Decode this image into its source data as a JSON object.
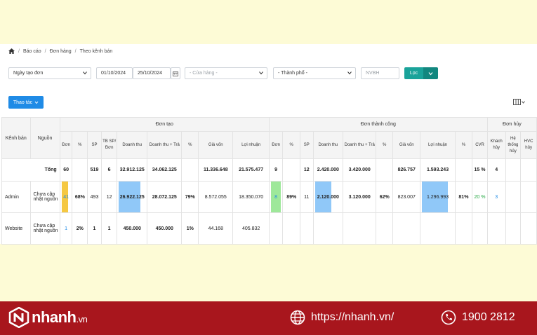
{
  "breadcrumb": [
    "Báo cáo",
    "Đơn hàng",
    "Theo kênh bán"
  ],
  "filters": {
    "date_type": "Ngày tạo đơn",
    "date_from": "01/10/2024",
    "date_to": "25/10/2024",
    "store_placeholder": "- Cửa hàng -",
    "city_placeholder": "- Thành phố -",
    "staff_placeholder": "NVBH",
    "filter_button": "Lọc"
  },
  "actions_button": "Thao tác",
  "table": {
    "group_headers": {
      "channel": "Kênh bán",
      "source": "Nguồn",
      "created": "Đơn tạo",
      "success": "Đơn thành công",
      "cancelled": "Đơn hủy"
    },
    "created_cols": [
      "Đơn",
      "%",
      "SP",
      "TB SP/ Đơn",
      "Doanh thu",
      "Doanh thu + Trả",
      "%",
      "Giá vốn",
      "Lợi nhuận"
    ],
    "success_cols": [
      "Đơn",
      "%",
      "SP",
      "Doanh thu",
      "Doanh thu + Trả",
      "%",
      "Giá vốn",
      "Lợi nhuận",
      "%",
      "CVR"
    ],
    "cancel_cols": [
      "Khách hủy",
      "Hệ thống hủy",
      "HVC hủy"
    ],
    "total": {
      "label": "Tổng",
      "created": [
        "60",
        "",
        "519",
        "6",
        "32.912.125",
        "34.062.125",
        "",
        "11.336.648",
        "21.575.477"
      ],
      "success": [
        "9",
        "",
        "12",
        "2.420.000",
        "3.420.000",
        "",
        "826.757",
        "1.593.243",
        "",
        "15 %"
      ],
      "cancel": [
        "4",
        "",
        ""
      ]
    },
    "rows": [
      {
        "channel": "Admin",
        "source": "Chưa cập nhật nguồn",
        "created": [
          "41",
          "68%",
          "493",
          "12",
          "26.922.125",
          "28.072.125",
          "79%",
          "8.572.055",
          "18.350.070"
        ],
        "success": [
          "8",
          "89%",
          "11",
          "2.120.000",
          "3.120.000",
          "62%",
          "823.007",
          "1.296.993",
          "81%",
          "20 %"
        ],
        "cancel": [
          "3",
          "",
          ""
        ]
      },
      {
        "channel": "Website",
        "source": "Chưa cập nhật nguồn",
        "created": [
          "1",
          "2%",
          "1",
          "1",
          "450.000",
          "450.000",
          "1%",
          "44.168",
          "405.832"
        ],
        "success": [
          "",
          "",
          "",
          "",
          "",
          "",
          "",
          "",
          "",
          ""
        ],
        "cancel": [
          "",
          "",
          ""
        ]
      }
    ],
    "highlights": {
      "orders_admin_fraction": 0.68,
      "revenue_admin_fraction": 0.79,
      "success_orders_admin_fraction": 0.89,
      "success_revenue_admin_fraction": 0.62,
      "success_profit_admin_fraction": 0.81,
      "colors": {
        "orders": "#f5c842",
        "revenue": "#90c8f8",
        "success_orders": "#9ee89a"
      }
    }
  },
  "footer": {
    "brand": "nhanh",
    "brand_suffix": ".vn",
    "website": "https://nhanh.vn/",
    "hotline": "1900 2812"
  }
}
